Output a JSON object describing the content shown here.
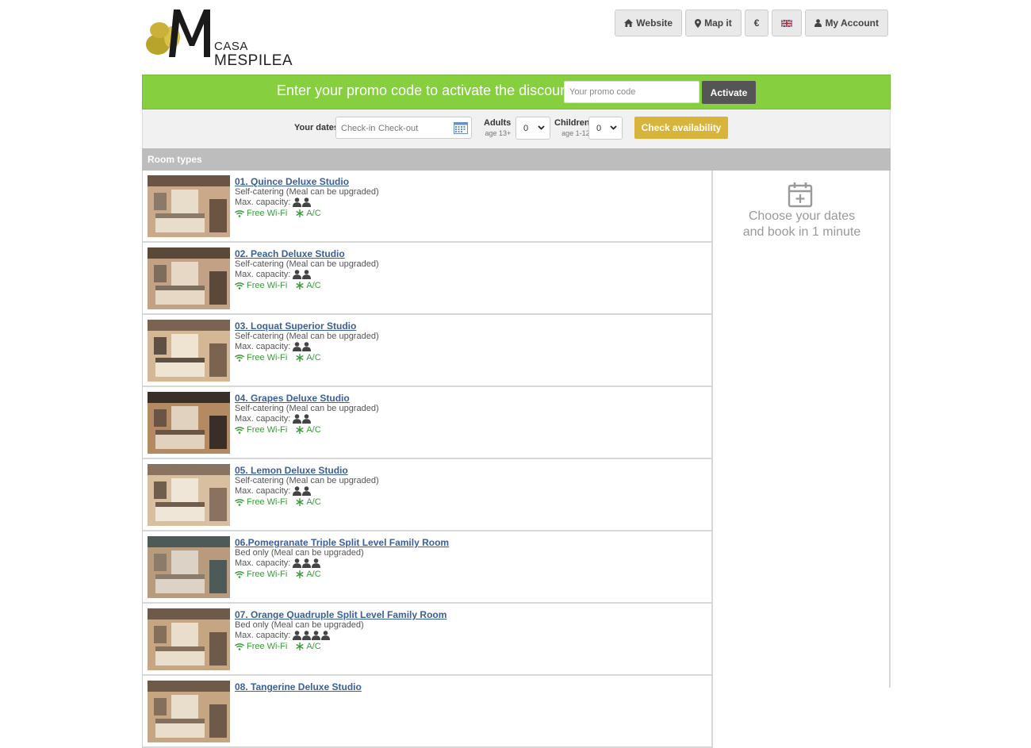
{
  "brand": {
    "line1": "CASA",
    "line2": "MESPILEA",
    "colors": {
      "olive": "#b8a42a",
      "gold": "#d9c24a",
      "dark": "#222222"
    }
  },
  "topnav": [
    {
      "icon": "home-icon",
      "label": "Website"
    },
    {
      "icon": "map-marker-icon",
      "label": "Map it"
    },
    {
      "icon": "",
      "label": "€"
    },
    {
      "icon": "uk-flag-icon",
      "label": ""
    },
    {
      "icon": "user-icon",
      "label": "My Account"
    }
  ],
  "promo": {
    "title": "Enter your promo code to activate the discount",
    "placeholder": "Your promo code",
    "button": "Activate",
    "bg": "#86cf3f"
  },
  "search": {
    "dates_label": "Your dates",
    "checkin_placeholder": "Check-in",
    "checkout_placeholder": "Check-out",
    "adults_label": "Adults",
    "adults_sub": "age 13+",
    "adults_value": "0",
    "children_label": "Children",
    "children_sub": "age 1-12",
    "children_value": "0",
    "check_button": "Check availability"
  },
  "room_types_header": "Room types",
  "capacity_label": "Max. capacity:",
  "amenities": {
    "wifi": "Free Wi-Fi",
    "ac": "A/C"
  },
  "rooms": [
    {
      "name": "01. Quince Deluxe Studio",
      "meal": "Self-catering (Meal can be upgraded)",
      "capacity": 2
    },
    {
      "name": "02. Peach Deluxe Studio",
      "meal": "Self-catering (Meal can be upgraded)",
      "capacity": 2
    },
    {
      "name": "03. Loquat Superior Studio",
      "meal": "Self-catering (Meal can be upgraded)",
      "capacity": 2
    },
    {
      "name": "04. Grapes Deluxe Studio",
      "meal": "Self-catering (Meal can be upgraded)",
      "capacity": 2
    },
    {
      "name": "05. Lemon Deluxe Studio",
      "meal": "Self-catering (Meal can be upgraded)",
      "capacity": 2
    },
    {
      "name": "06.Pomegranate Triple Split Level Family Room",
      "meal": "Bed only (Meal can be upgraded)",
      "capacity": 3
    },
    {
      "name": "07. Orange Quadruple Split Level Family Room",
      "meal": "Bed only (Meal can be upgraded)",
      "capacity": 4
    },
    {
      "name": "08. Tangerine Deluxe Studio",
      "meal": "",
      "capacity": 0
    }
  ],
  "sidebar": {
    "line1": "Choose your dates",
    "line2": "and book in 1 minute"
  }
}
